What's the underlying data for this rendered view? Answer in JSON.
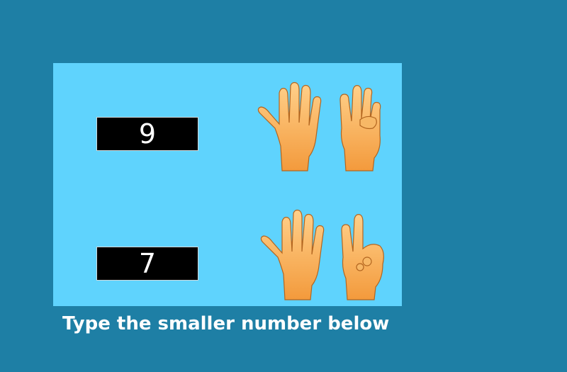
{
  "numbers": {
    "first": "9",
    "second": "7"
  },
  "prompt": "Type the smaller number below",
  "icons": {
    "hands_a": "hands-nine-fingers-icon",
    "hands_b": "hands-seven-fingers-icon"
  },
  "colors": {
    "background": "#1e7fa5",
    "panel": "#5fd3fd",
    "box": "#000000",
    "skin": "#f5a64a"
  }
}
